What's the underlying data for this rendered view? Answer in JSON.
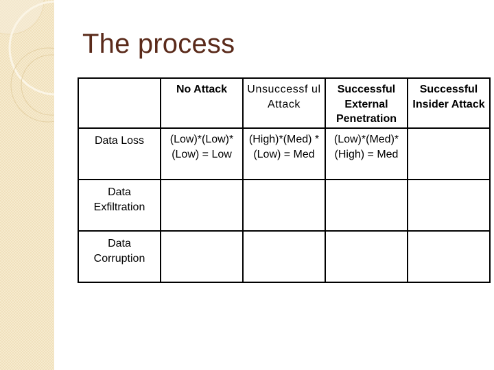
{
  "slide": {
    "title": "The process",
    "accent_color": "#5a2a1a",
    "sidebar_color": "#f0e0bc"
  },
  "table": {
    "corner": "",
    "columns": [
      "No Attack",
      "Unsuccessf ul Attack",
      "Successful External Penetration",
      "Successful Insider Attack"
    ],
    "rows": [
      {
        "label": "Data Loss",
        "cells": [
          "(Low)*(Low)* (Low) = Low",
          "(High)*(Med) * (Low) = Med",
          "(Low)*(Med)* (High) = Med",
          ""
        ]
      },
      {
        "label": "Data Exfiltration",
        "cells": [
          "",
          "",
          "",
          ""
        ]
      },
      {
        "label": "Data Corruption",
        "cells": [
          "",
          "",
          "",
          ""
        ]
      }
    ]
  }
}
